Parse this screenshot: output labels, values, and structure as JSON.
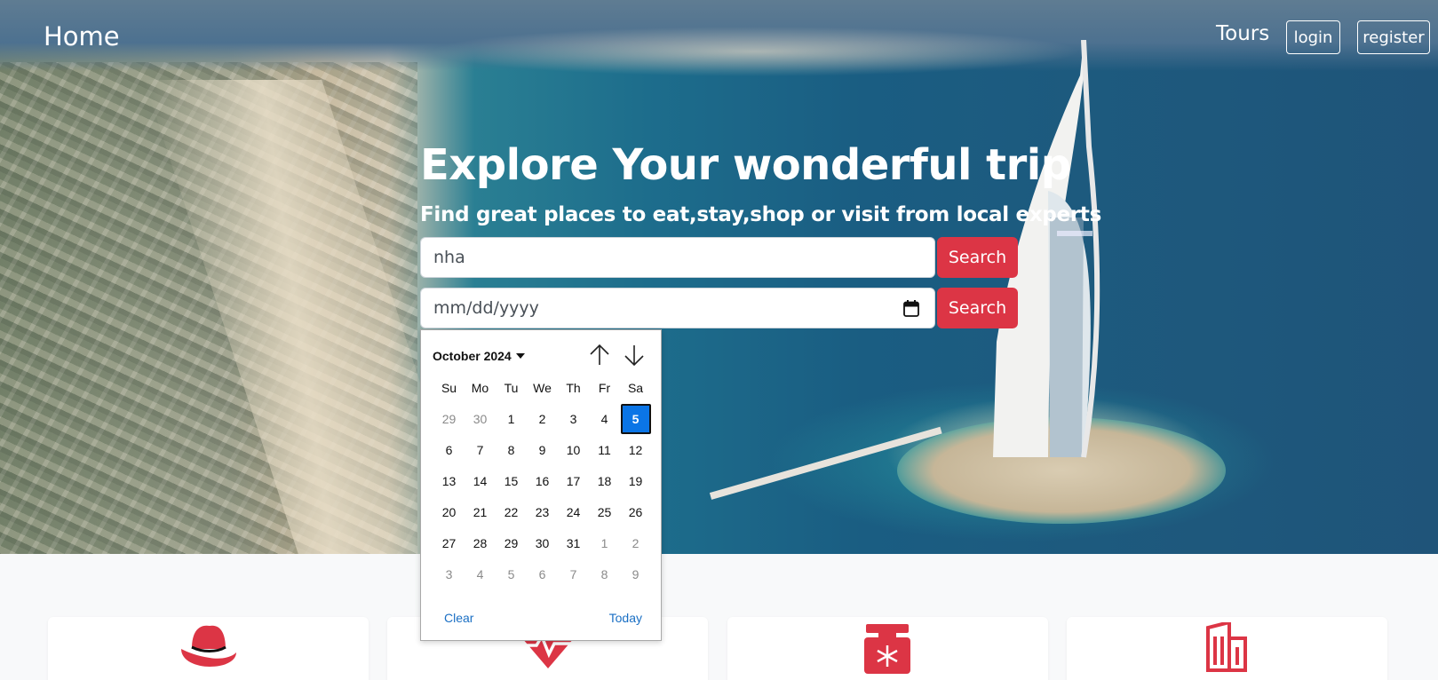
{
  "nav": {
    "home": "Home",
    "tours": "Tours",
    "login": "login",
    "register": "register"
  },
  "hero": {
    "title": "Explore Your wonderful trip",
    "subtitle": "Find great places to eat,stay,shop or visit from local experts"
  },
  "search": {
    "text_value": "nha",
    "text_button": "Search",
    "date_placeholder": "mm/dd/yyyy",
    "date_button": "Search"
  },
  "datepicker": {
    "month_label": "October 2024",
    "weekdays": [
      "Su",
      "Mo",
      "Tu",
      "We",
      "Th",
      "Fr",
      "Sa"
    ],
    "weeks": [
      [
        "29",
        "30",
        "1",
        "2",
        "3",
        "4",
        "5"
      ],
      [
        "6",
        "7",
        "8",
        "9",
        "10",
        "11",
        "12"
      ],
      [
        "13",
        "14",
        "15",
        "16",
        "17",
        "18",
        "19"
      ],
      [
        "20",
        "21",
        "22",
        "23",
        "24",
        "25",
        "26"
      ],
      [
        "27",
        "28",
        "29",
        "30",
        "31",
        "1",
        "2"
      ],
      [
        "3",
        "4",
        "5",
        "6",
        "7",
        "8",
        "9"
      ]
    ],
    "selected_day": "5",
    "clear_label": "Clear",
    "today_label": "Today"
  },
  "cards": [
    {
      "icon": "hat-icon"
    },
    {
      "icon": "heart-pulse-icon"
    },
    {
      "icon": "cooler-snowflake-icon"
    },
    {
      "icon": "building-icon"
    }
  ],
  "colors": {
    "accent": "#dc3545",
    "selected_day": "#0b75e6",
    "link": "#1a6fc4"
  }
}
